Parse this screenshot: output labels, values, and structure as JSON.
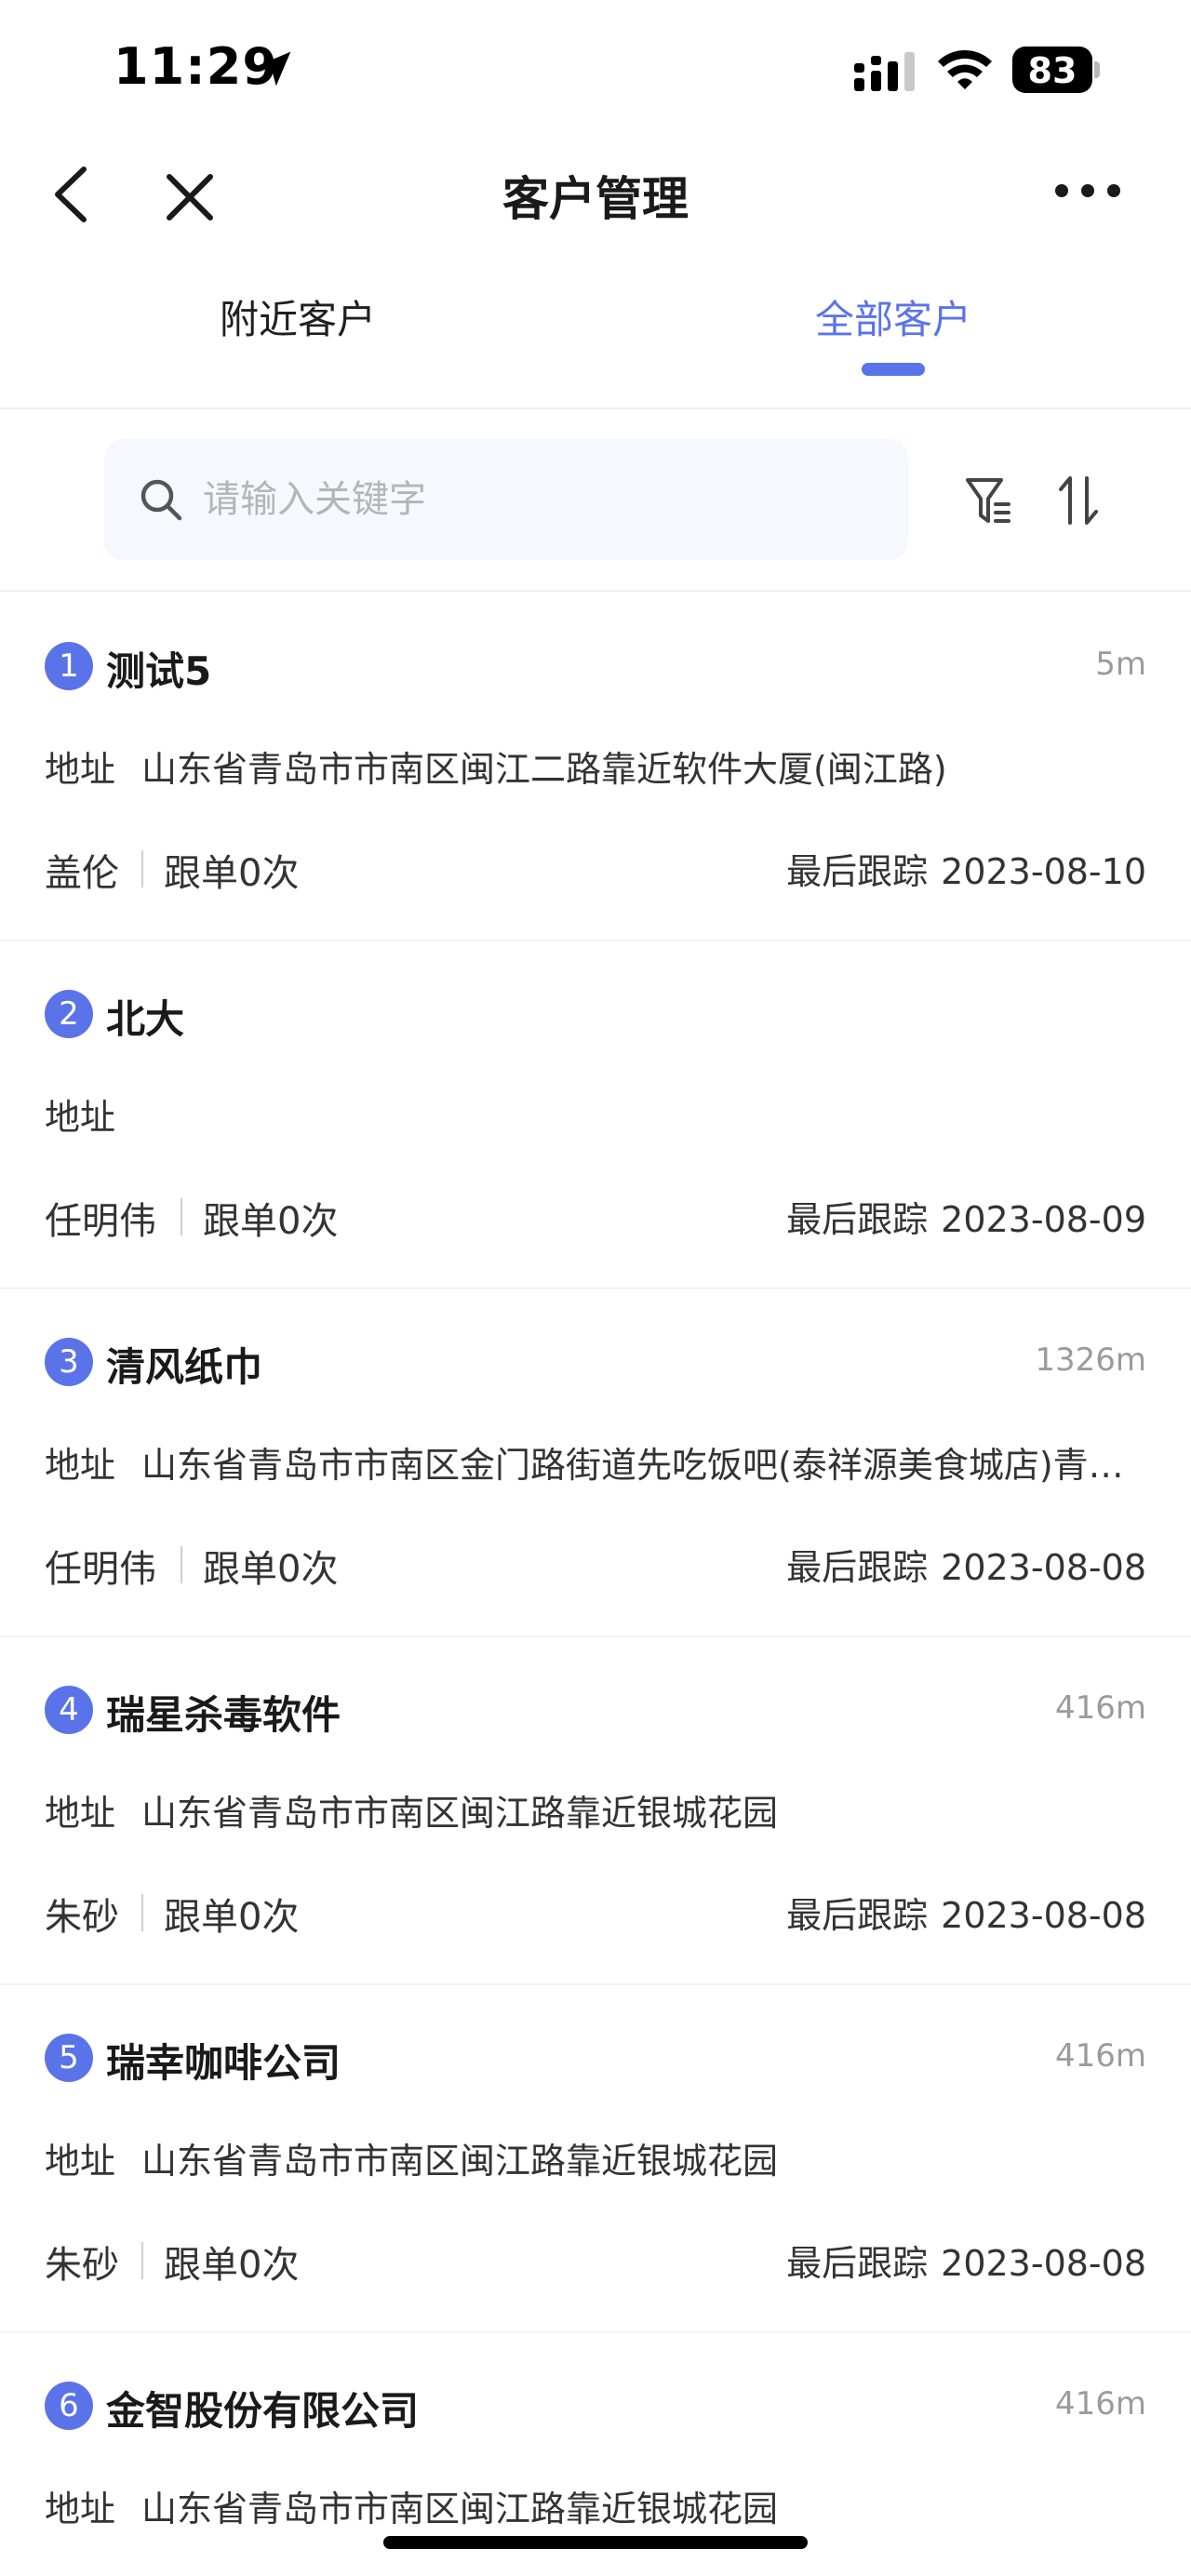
{
  "status_bar": {
    "time": "11:29",
    "battery": "83"
  },
  "nav": {
    "title": "客户管理"
  },
  "tabs": [
    {
      "label": "附近客户",
      "active": false
    },
    {
      "label": "全部客户",
      "active": true
    }
  ],
  "search": {
    "placeholder": "请输入关键字"
  },
  "colors": {
    "accent": "#5b73e8",
    "muted": "#9b9b9b"
  },
  "list_labels": {
    "address": "地址",
    "last_track": "最后跟踪"
  },
  "customers": [
    {
      "index": "1",
      "name": "测试5",
      "distance": "5m",
      "address": "山东省青岛市市南区闽江二路靠近软件大厦(闽江路)",
      "owner": "盖伦",
      "follow": "跟单0次",
      "last_date": "2023-08-10"
    },
    {
      "index": "2",
      "name": "北大",
      "distance": "",
      "address": "",
      "owner": "任明伟",
      "follow": "跟单0次",
      "last_date": "2023-08-09"
    },
    {
      "index": "3",
      "name": "清风纸巾",
      "distance": "1326m",
      "address": "山东省青岛市市南区金门路街道先吃饭吧(泰祥源美食城店)青岛市市南区",
      "owner": "任明伟",
      "follow": "跟单0次",
      "last_date": "2023-08-08"
    },
    {
      "index": "4",
      "name": "瑞星杀毒软件",
      "distance": "416m",
      "address": "山东省青岛市市南区闽江路靠近银城花园",
      "owner": "朱砂",
      "follow": "跟单0次",
      "last_date": "2023-08-08"
    },
    {
      "index": "5",
      "name": "瑞幸咖啡公司",
      "distance": "416m",
      "address": "山东省青岛市市南区闽江路靠近银城花园",
      "owner": "朱砂",
      "follow": "跟单0次",
      "last_date": "2023-08-08"
    },
    {
      "index": "6",
      "name": "金智股份有限公司",
      "distance": "416m",
      "address": "山东省青岛市市南区闽江路靠近银城花园",
      "owner": "",
      "follow": "",
      "last_date": ""
    }
  ]
}
